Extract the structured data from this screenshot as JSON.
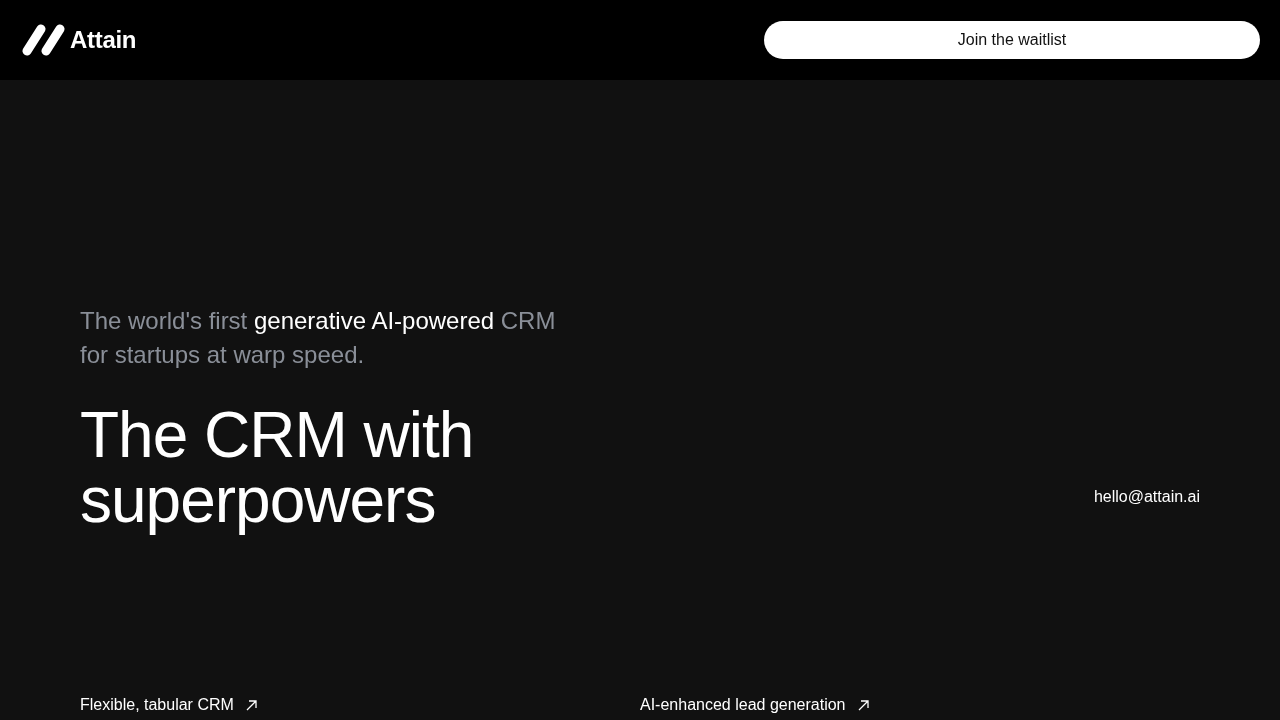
{
  "header": {
    "logo": {
      "text": "Attain"
    },
    "cta_button": {
      "label": "Join the waitlist"
    }
  },
  "hero": {
    "tagline": "The world's first **generative AI-powered** CRM for startups at warp speed.",
    "headline": "The CRM with superpowers",
    "contact_email": "hello@attain.ai"
  },
  "feature_links": [
    {
      "label": "Flexible, tabular CRM"
    },
    {
      "label": "AI-enhanced lead generation"
    }
  ]
}
